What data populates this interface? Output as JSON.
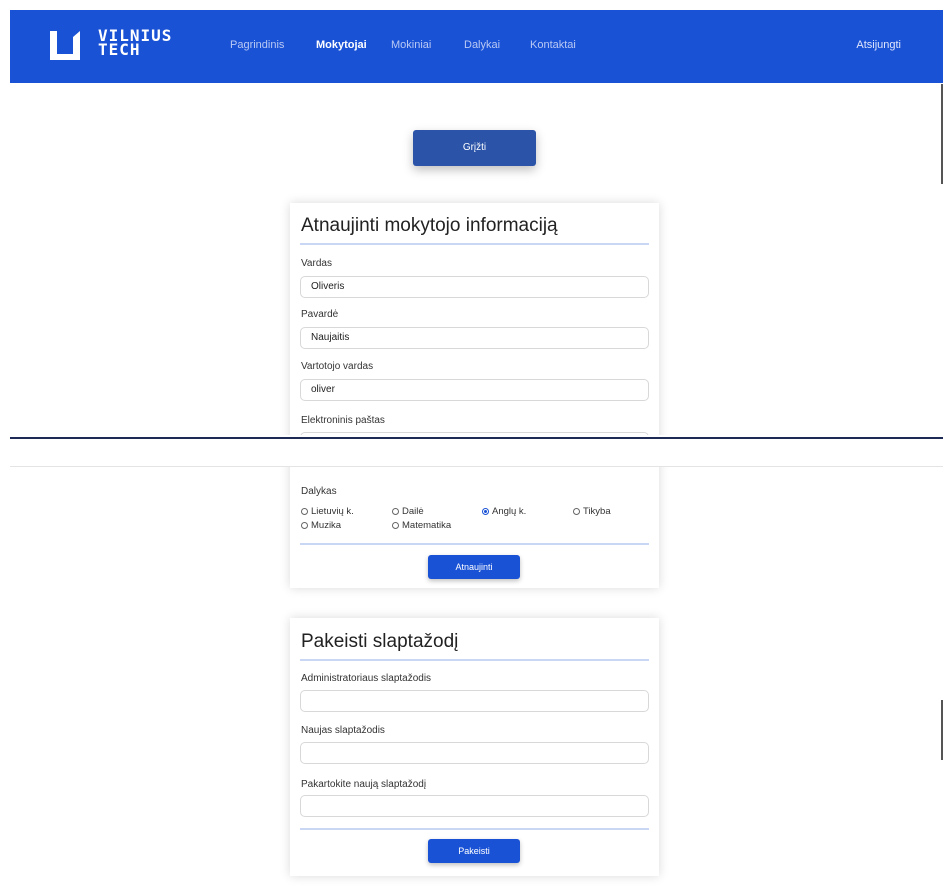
{
  "header": {
    "logo_line1": "VILNIUS",
    "logo_line2": "TECH",
    "nav": [
      "Pagrindinis",
      "Mokytojai",
      "Mokiniai",
      "Dalykai",
      "Kontaktai"
    ],
    "active_nav": "Mokytojai",
    "logout": "Atsijungti"
  },
  "back_button": "Grįžti",
  "update_form": {
    "title": "Atnaujinti mokytojo informaciją",
    "first_name_label": "Vardas",
    "first_name_value": "Oliveris",
    "last_name_label": "Pavardė",
    "last_name_value": "Naujaitis",
    "username_label": "Vartotojo vardas",
    "username_value": "oliver",
    "email_label": "Elektroninis paštas",
    "subject_label": "Dalykas",
    "subjects": [
      "Lietuvių k.",
      "Dailė",
      "Anglų k.",
      "Tikyba",
      "Muzika",
      "Matematika"
    ],
    "selected_subject": "Anglų k.",
    "submit": "Atnaujinti"
  },
  "password_form": {
    "title": "Pakeisti slaptažodį",
    "admin_password_label": "Administratoriaus slaptažodis",
    "new_password_label": "Naujas slaptažodis",
    "repeat_password_label": "Pakartokite naują slaptažodį",
    "submit": "Pakeisti"
  },
  "colors": {
    "brand": "#1a52d6",
    "back_button": "#2b54a8",
    "rule": "#c9d7f5"
  }
}
